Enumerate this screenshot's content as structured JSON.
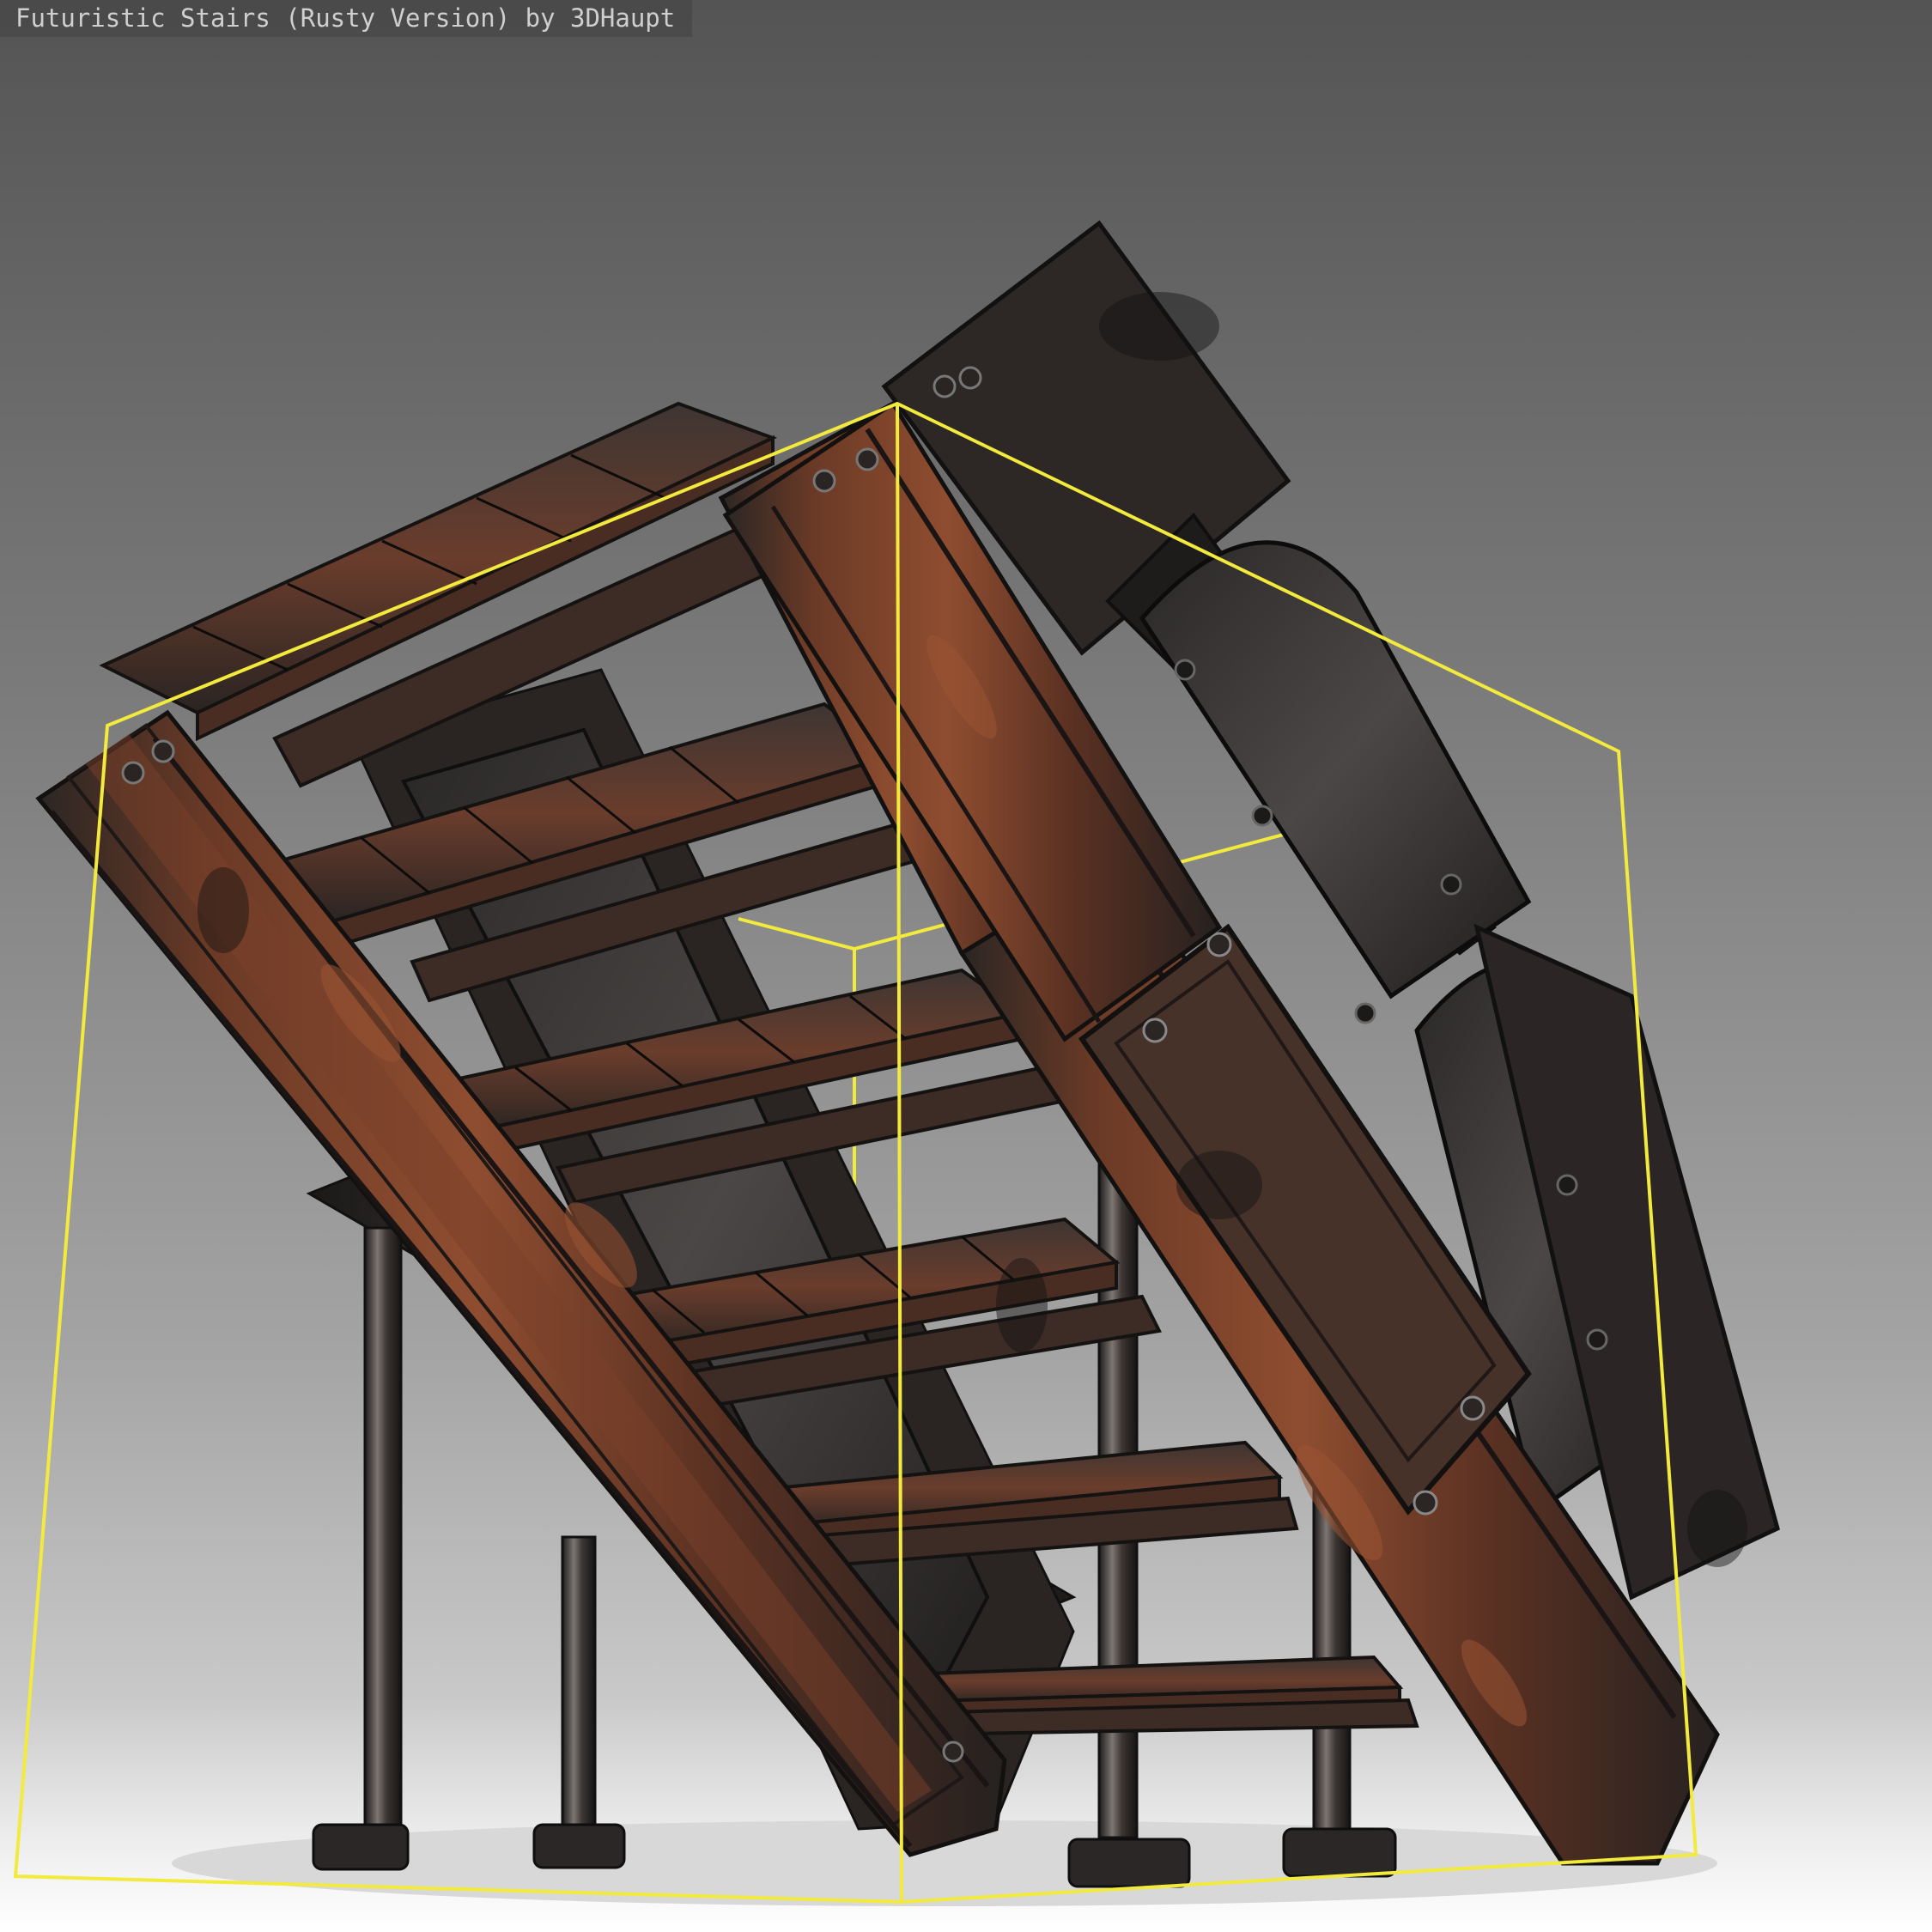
{
  "viewer": {
    "title": "Futuristic Stairs (Rusty Version) by 3DHaupt"
  },
  "scene": {
    "model": "rusty futuristic staircase",
    "bounding_box_color": "#f2ea3c",
    "background_top": "#545454",
    "background_bottom": "#ffffff",
    "metal_color": "#3a3532",
    "rust_color": "#8a4a2e"
  }
}
